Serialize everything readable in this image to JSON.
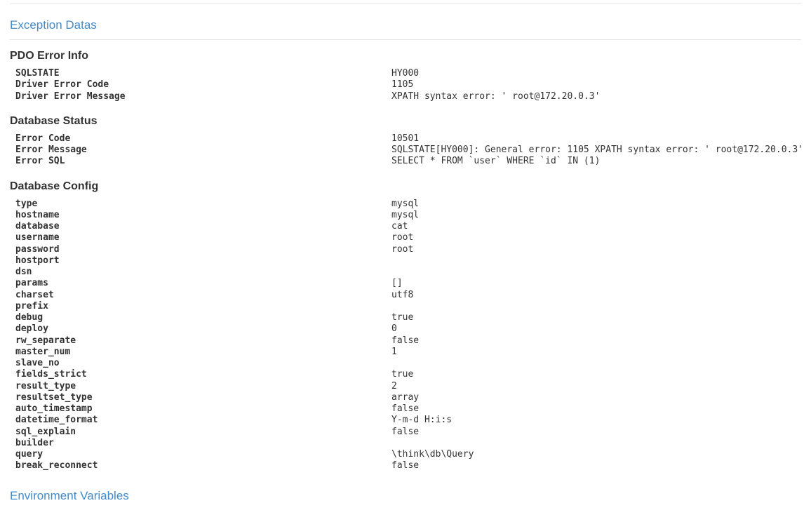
{
  "sections": {
    "exception_datas": "Exception Datas",
    "environment_variables": "Environment Variables"
  },
  "blocks": [
    {
      "title": "PDO Error Info",
      "rows": [
        {
          "key": "SQLSTATE",
          "val": "HY000"
        },
        {
          "key": "Driver Error Code",
          "val": "1105"
        },
        {
          "key": "Driver Error Message",
          "val": "XPATH syntax error: ' root@172.20.0.3'"
        }
      ]
    },
    {
      "title": "Database Status",
      "rows": [
        {
          "key": "Error Code",
          "val": "10501"
        },
        {
          "key": "Error Message",
          "val": "SQLSTATE[HY000]: General error: 1105 XPATH syntax error: ' root@172.20.0.3'"
        },
        {
          "key": "Error SQL",
          "val": "SELECT * FROM `user` WHERE `id` IN (1)"
        }
      ]
    },
    {
      "title": "Database Config",
      "rows": [
        {
          "key": "type",
          "val": "mysql"
        },
        {
          "key": "hostname",
          "val": "mysql"
        },
        {
          "key": "database",
          "val": "cat"
        },
        {
          "key": "username",
          "val": "root"
        },
        {
          "key": "password",
          "val": "root"
        },
        {
          "key": "hostport",
          "val": ""
        },
        {
          "key": "dsn",
          "val": ""
        },
        {
          "key": "params",
          "val": "[]"
        },
        {
          "key": "charset",
          "val": "utf8"
        },
        {
          "key": "prefix",
          "val": ""
        },
        {
          "key": "debug",
          "val": "true"
        },
        {
          "key": "deploy",
          "val": "0"
        },
        {
          "key": "rw_separate",
          "val": "false"
        },
        {
          "key": "master_num",
          "val": "1"
        },
        {
          "key": "slave_no",
          "val": ""
        },
        {
          "key": "fields_strict",
          "val": "true"
        },
        {
          "key": "result_type",
          "val": "2"
        },
        {
          "key": "resultset_type",
          "val": "array"
        },
        {
          "key": "auto_timestamp",
          "val": "false"
        },
        {
          "key": "datetime_format",
          "val": "Y-m-d H:i:s"
        },
        {
          "key": "sql_explain",
          "val": "false"
        },
        {
          "key": "builder",
          "val": ""
        },
        {
          "key": "query",
          "val": "\\think\\db\\Query"
        },
        {
          "key": "break_reconnect",
          "val": "false"
        }
      ]
    }
  ]
}
